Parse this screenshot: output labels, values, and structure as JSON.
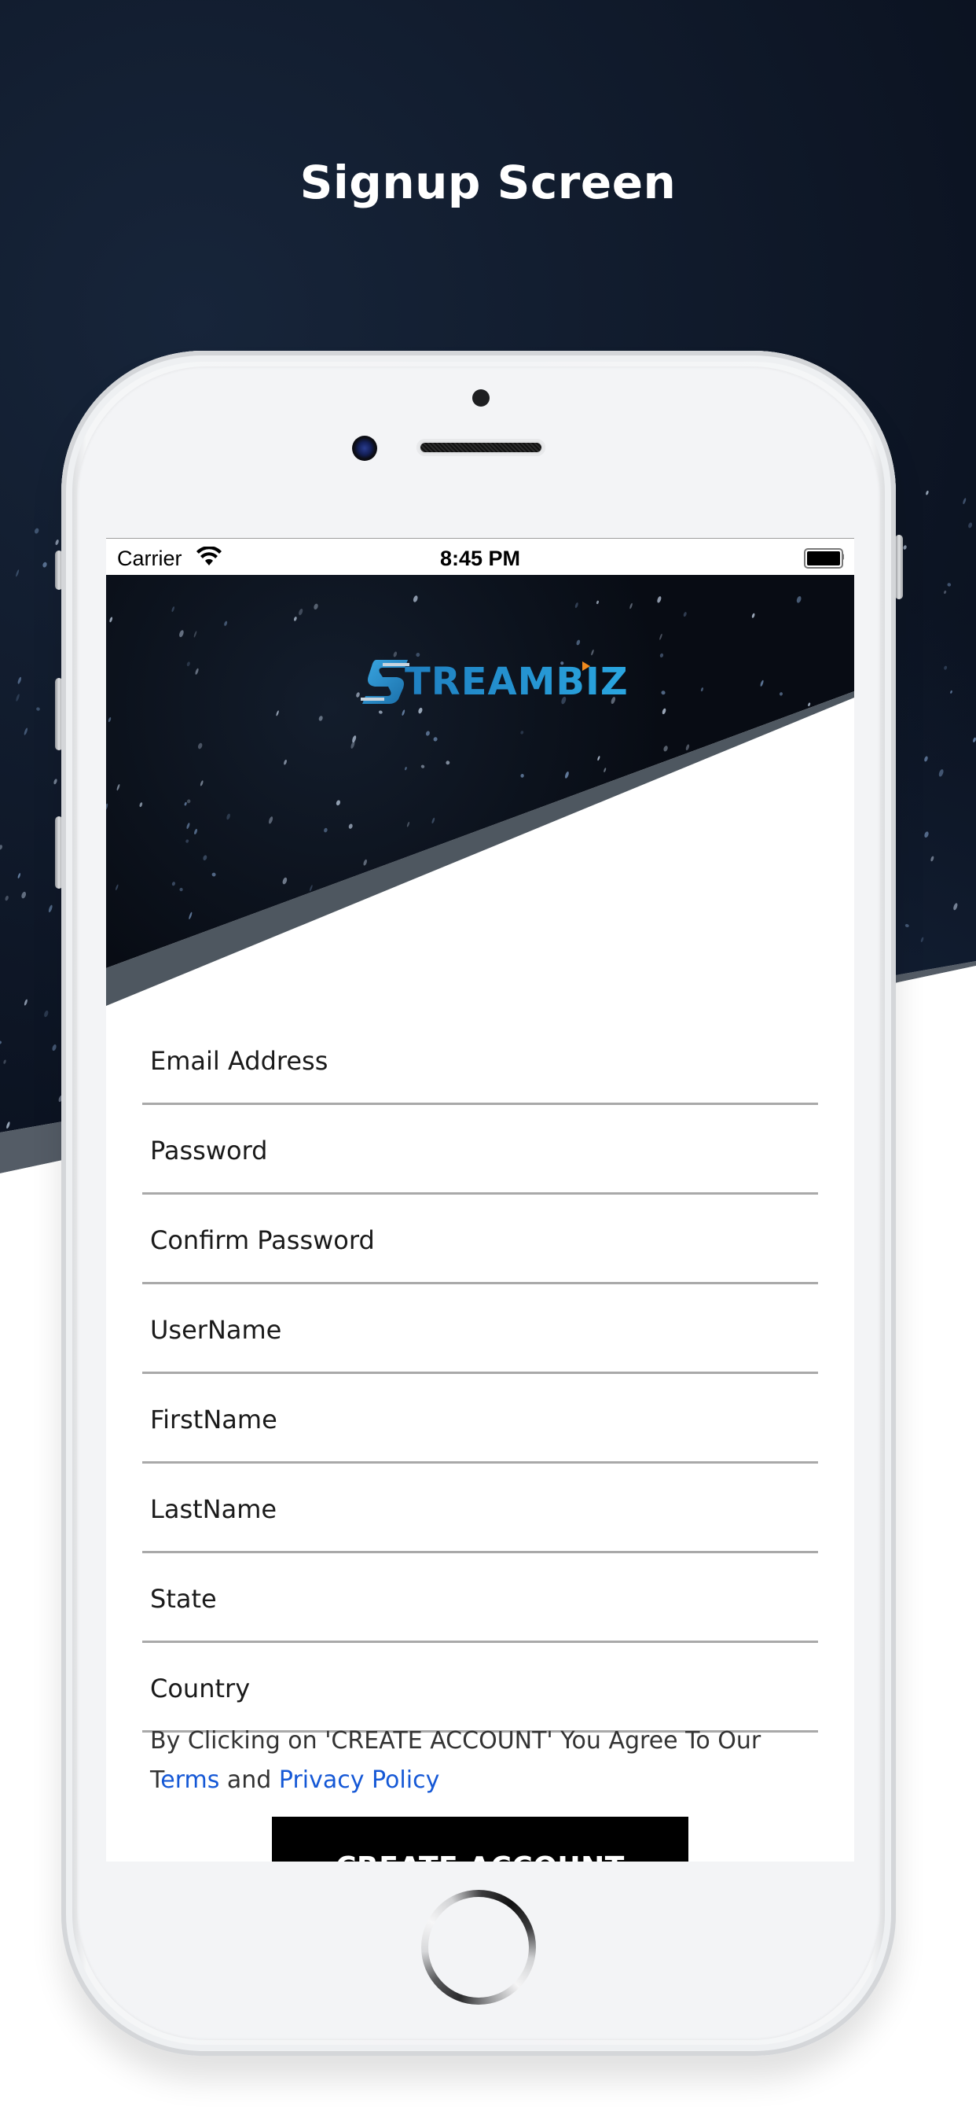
{
  "page": {
    "title": "Signup Screen"
  },
  "colors": {
    "background_dark": "#0b1220",
    "band_gray": "#545c66",
    "link_blue": "#1558d6",
    "button_black": "#000000",
    "logo_blue": "#2aa6e0",
    "logo_accent_orange": "#f08a1e"
  },
  "status_bar": {
    "carrier": "Carrier",
    "time": "8:45 PM",
    "wifi_icon": "wifi-icon",
    "battery_icon": "battery-icon",
    "battery_level": 1.0
  },
  "app": {
    "logo_text": "TREAMBIZ",
    "logo_full_name": "STREAMBIZ"
  },
  "form": {
    "fields": [
      {
        "name": "email",
        "placeholder": "Email Address",
        "value": ""
      },
      {
        "name": "password",
        "placeholder": "Password",
        "value": ""
      },
      {
        "name": "confirm-password",
        "placeholder": "Confirm Password",
        "value": ""
      },
      {
        "name": "username",
        "placeholder": "UserName",
        "value": ""
      },
      {
        "name": "firstname",
        "placeholder": "FirstName",
        "value": ""
      },
      {
        "name": "lastname",
        "placeholder": "LastName",
        "value": ""
      },
      {
        "name": "state",
        "placeholder": "State",
        "value": ""
      },
      {
        "name": "country",
        "placeholder": "Country",
        "value": ""
      }
    ],
    "terms": {
      "prefix": "By Clicking on 'CREATE ACCOUNT' You Agree To Our T",
      "terms_link": "erms",
      "conjunction": " and ",
      "privacy_link": "Privacy Policy"
    },
    "submit_label": "CREATE ACCOUNT"
  }
}
